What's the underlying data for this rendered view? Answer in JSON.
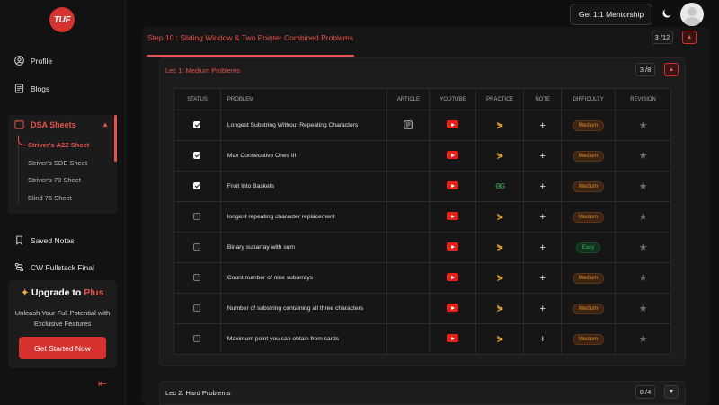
{
  "sidebar": {
    "logo": "TUF",
    "profile": "Profile",
    "blogs": "Blogs",
    "dsa_sheets": "DSA Sheets",
    "sheets": [
      "Striver's A2Z Sheet",
      "Striver's SDE Sheet",
      "Striver's 79 Sheet",
      "Blind 75 Sheet"
    ],
    "saved_notes": "Saved Notes",
    "cw_fullstack": "CW Fullstack Final",
    "upgrade": {
      "title_prefix": "Upgrade to ",
      "title_plus": "Plus",
      "desc": "Unleash Your Full Potential with Exclusive Features",
      "button": "Get Started Now"
    }
  },
  "header": {
    "mentorship": "Get 1:1 Mentorship"
  },
  "step": {
    "title": "Step 10 : Sliding Window & Two Pointer Combined Problems",
    "count": "3 /12"
  },
  "lectures": [
    {
      "title": "Lec 1: Medium Problems",
      "count": "3 /8"
    },
    {
      "title": "Lec 2: Hard Problems",
      "count": "0 /4"
    }
  ],
  "table": {
    "headers": [
      "STATUS",
      "PROBLEM",
      "ARTICLE",
      "YOUTUBE",
      "PRACTICE",
      "NOTE",
      "DIFFICULTY",
      "REVISION"
    ],
    "rows": [
      {
        "done": true,
        "problem": "Longest Substring Without Repeating Characters",
        "article": true,
        "practice": "codingninjas",
        "difficulty": "Medium"
      },
      {
        "done": true,
        "problem": "Max Consecutive Ones III",
        "article": false,
        "practice": "codingninjas",
        "difficulty": "Medium"
      },
      {
        "done": true,
        "problem": "Fruit Into Baskets",
        "article": false,
        "practice": "gfg",
        "difficulty": "Medium"
      },
      {
        "done": false,
        "problem": "longest repeating character replacement",
        "article": false,
        "practice": "codingninjas",
        "difficulty": "Medium"
      },
      {
        "done": false,
        "problem": "Binary subarray with sum",
        "article": false,
        "practice": "codingninjas",
        "difficulty": "Easy"
      },
      {
        "done": false,
        "problem": "Count number of nice subarrays",
        "article": false,
        "practice": "codingninjas",
        "difficulty": "Medium"
      },
      {
        "done": false,
        "problem": "Number of substring containing all three characters",
        "article": false,
        "practice": "codingninjas",
        "difficulty": "Medium"
      },
      {
        "done": false,
        "problem": "Maximum point you can obtain from cards",
        "article": false,
        "practice": "codingninjas",
        "difficulty": "Medium"
      }
    ]
  },
  "colors": {
    "accent": "#e5534b",
    "medium": "#e0892e",
    "easy": "#39b35a",
    "youtube": "#e62117"
  }
}
